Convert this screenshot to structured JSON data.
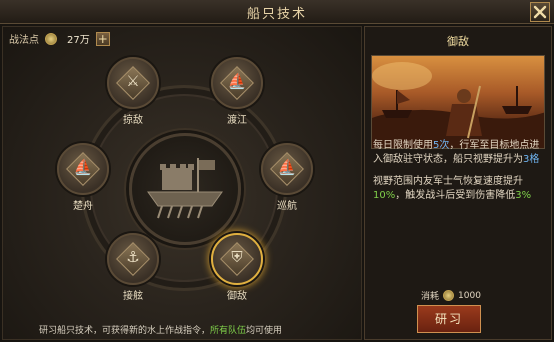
{
  "header": {
    "title": "船只技术"
  },
  "points": {
    "label": "战法点",
    "value": "27万",
    "add_label": "+"
  },
  "skills": [
    {
      "name": "掠敌",
      "glyph": "⚔"
    },
    {
      "name": "渡江",
      "glyph": "⛵"
    },
    {
      "name": "楚舟",
      "glyph": "⛵"
    },
    {
      "name": "巡航",
      "glyph": "⛵"
    },
    {
      "name": "接舷",
      "glyph": "⚓"
    },
    {
      "name": "御敌",
      "glyph": "⛨",
      "selected": true
    }
  ],
  "footer_note": {
    "prefix": "研习船只技术，可获得新的水上作战指令，",
    "highlight": "所有队伍",
    "suffix": "均可使用"
  },
  "detail": {
    "name": "御敌",
    "desc1_a": "每日限制使用",
    "desc1_b": "5次",
    "desc1_c": "，行军至目标地点进入御敌驻守状态，船只视野提升为",
    "desc1_d": "3格",
    "desc2_a": "视野范围内友军士气恢复速度提升",
    "desc2_b": "10%",
    "desc2_c": "，触发战斗后受到伤害降低",
    "desc2_d": "3%",
    "cost_label": "消耗",
    "cost_value": "1000",
    "study_label": "研习"
  },
  "colors": {
    "accent_gold": "#e0b040",
    "highlight_green": "#7fcf4a",
    "highlight_blue": "#6fb4f0",
    "button_red": "#9a3a1c"
  }
}
